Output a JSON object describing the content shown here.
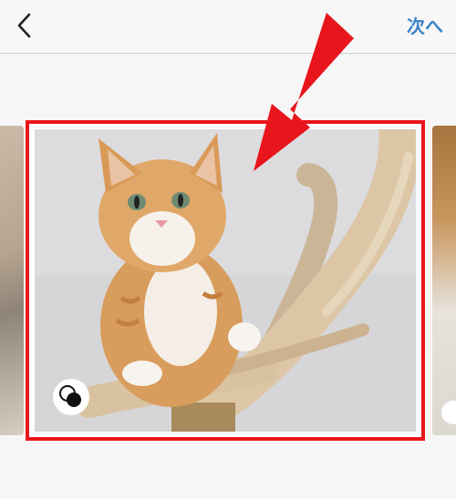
{
  "header": {
    "back_icon": "chevron-left-icon",
    "next_label": "次へ",
    "accent_color": "#3b82c6"
  },
  "carousel": {
    "selected_index": 1,
    "highlight_color": "#e8161c",
    "main_photo_subject": "",
    "multi_select_icon": "multi-select-icon"
  },
  "annotation": {
    "arrow_color": "#e8161c",
    "arrow_icon": "pointer-arrow-icon"
  }
}
